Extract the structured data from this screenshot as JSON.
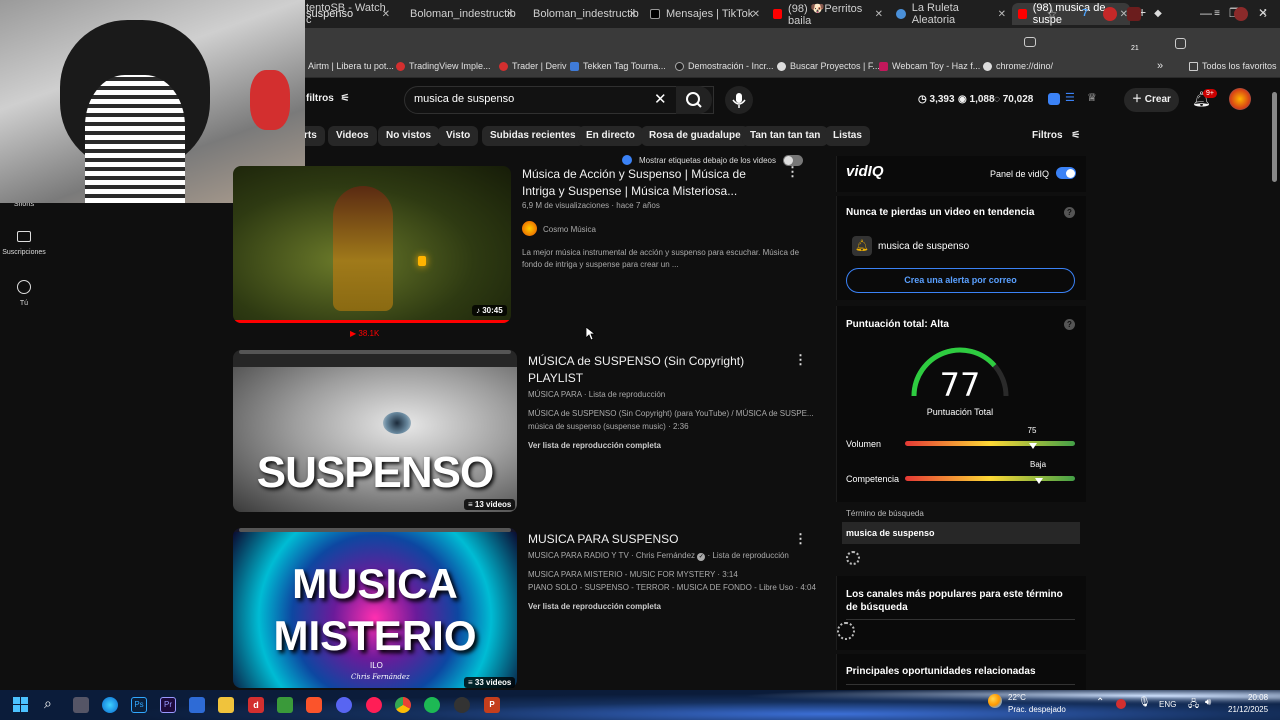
{
  "browser": {
    "tabs": [
      {
        "label": "tentoSB - Watch c",
        "color": "#7a5af8"
      },
      {
        "label": "Boloman_indestructib",
        "color": "#1db954"
      },
      {
        "label": "Boloman_indestructib",
        "color": "#1db954"
      },
      {
        "label": "Mensajes | TikTok",
        "color": "#000000"
      },
      {
        "label": "(98) 🐶Perritos baila",
        "color": "#ff0000"
      },
      {
        "label": "La Ruleta Aleatoria",
        "color": "#4a90d9"
      },
      {
        "label": "(98) musica de suspe",
        "color": "#ff0000"
      }
    ],
    "new_tab": "+",
    "address": "suspenso",
    "bookmarks": [
      "Airtm | Libera tu pot...",
      "TradingView Imple...",
      "Trader | Deriv",
      "Tekken Tag Tourna...",
      "Demostración - Incr...",
      "Buscar Proyectos | F...",
      "Webcam Toy - Haz f...",
      "chrome://dino/"
    ],
    "all_bookmarks": "Todos los favoritos",
    "ext_badge": "21"
  },
  "header": {
    "filters": "filtros",
    "search_value": "musica de suspenso",
    "stats": {
      "s1": "3,393",
      "s2": "1,088",
      "s3": "70,028"
    },
    "create": "Crear",
    "notif_count": "9+"
  },
  "chips": [
    "rts",
    "Videos",
    "No vistos",
    "Visto",
    "Subidas recientes",
    "En directo",
    "Rosa de guadalupe",
    "Tan tan tan tan",
    "Listas"
  ],
  "filters_label": "Filtros",
  "show_tags": "Mostrar etiquetas debajo de los videos",
  "nav": [
    {
      "label": "Shorts"
    },
    {
      "label": "Suscripciones"
    },
    {
      "label": "Tú"
    }
  ],
  "videos": [
    {
      "title": "Música de Acción y Suspenso | Música de Intriga y Suspense | Música Misteriosa...",
      "meta": "6,9 M de visualizaciones · hace 7 años",
      "channel": "Cosmo Música",
      "desc_line1": "La mejor música instrumental de acción y suspenso para escuchar. Música de",
      "desc_line2": "fondo de intriga y suspense para crear un ...",
      "duration": "30:45",
      "under": "38.1K"
    },
    {
      "title_l1": "MÚSICA de SUSPENSO (Sin Copyright)",
      "title_l2": "PLAYLIST",
      "meta": "MÚSICA PARA · Lista de reproducción",
      "line1": "MÚSICA de SUSPENSO (Sin Copyright) (para YouTube) / MÚSICA de SUSPE...",
      "line2": "música de suspenso (suspense music) · 2:36",
      "link": "Ver lista de reproducción completa",
      "thumb_text": "SUSPENSO",
      "count": "13 videos"
    },
    {
      "title": "MUSICA PARA  SUSPENSO",
      "meta": "MUSICA PARA RADIO Y TV · Chris Fernández",
      "meta_tail": "· Lista de reproducción",
      "line1": "MUSICA PARA MISTERIO - MUSIC FOR MYSTERY · 3:14",
      "line2": "PIANO SOLO - SUSPENSO - TERROR - MUSICA DE FONDO - Libre Uso · 4:04",
      "link": "Ver lista de reproducción completa",
      "thumb_l1": "MUSICA",
      "thumb_l2": "MISTERIO",
      "thumb_small": "ILO",
      "thumb_sign": "Chris Fernández",
      "count": "33 videos"
    }
  ],
  "vidiq": {
    "logo": "vidIQ",
    "panel_label": "Panel de vidIQ",
    "trend_title": "Nunca te pierdas un video en tendencia",
    "trend_term": "musica de suspenso",
    "alert_btn": "Crea una alerta por correo",
    "score_title": "Puntuación total: Alta",
    "score": 77,
    "score_label": "Puntuación Total",
    "volume_label": "Volumen",
    "volume_value": 75,
    "volume_marker": "75",
    "competition_label": "Competencia",
    "competition_value": "Baja",
    "term_label": "Término de búsqueda",
    "term_value": "musica de suspenso",
    "channels_title_l1": "Los canales más populares para este término",
    "channels_title_l2": "de búsqueda",
    "opps_title": "Principales oportunidades relacionadas"
  },
  "taskbar": {
    "weather_temp": "22°C",
    "weather_desc": "Prac. despejado",
    "lang": "ENG",
    "time": "20:08",
    "date": "21/12/2025"
  },
  "colors": {
    "accent_red": "#ff0000",
    "vidiq_blue": "#3b82f6",
    "link_blue": "#3ea6ff",
    "gauge_green": "#2ecc40"
  }
}
